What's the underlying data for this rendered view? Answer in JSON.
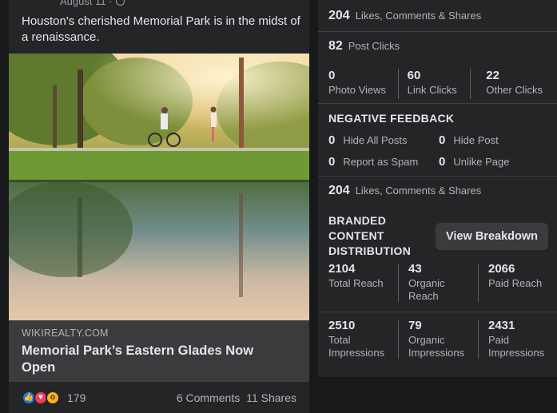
{
  "post": {
    "date": "August 11 ·",
    "text": "Houston's cherished Memorial Park is in the midst of a renaissance.",
    "link_domain": "WIKIREALTY.COM",
    "link_title": "Memorial Park’s Eastern Glades Now Open",
    "reaction_count": "179",
    "comments": "6 Comments",
    "shares": "11 Shares",
    "reaction_icons": [
      "like-icon",
      "love-icon",
      "wow-icon"
    ]
  },
  "insights": {
    "engagement_top": {
      "value": "204",
      "label": "Likes, Comments & Shares"
    },
    "post_clicks": {
      "value": "82",
      "label": "Post Clicks"
    },
    "clicks": [
      {
        "value": "0",
        "label": "Photo Views"
      },
      {
        "value": "60",
        "label": "Link Clicks"
      },
      {
        "value": "22",
        "label": "Other Clicks"
      }
    ],
    "negative_feedback": {
      "heading": "NEGATIVE FEEDBACK",
      "items": [
        {
          "value": "0",
          "label": "Hide All Posts"
        },
        {
          "value": "0",
          "label": "Hide Post"
        },
        {
          "value": "0",
          "label": "Report as Spam"
        },
        {
          "value": "0",
          "label": "Unlike Page"
        }
      ]
    },
    "engagement_bottom": {
      "value": "204",
      "label": "Likes, Comments & Shares"
    },
    "branded": {
      "heading": "BRANDED CONTENT DISTRIBUTION",
      "button": "View Breakdown",
      "reach": [
        {
          "value": "2104",
          "label": "Total Reach"
        },
        {
          "value": "43",
          "label": "Organic Reach"
        },
        {
          "value": "2066",
          "label": "Paid Reach"
        }
      ],
      "impressions": [
        {
          "value": "2510",
          "label": "Total Impressions"
        },
        {
          "value": "79",
          "label": "Organic Impressions"
        },
        {
          "value": "2431",
          "label": "Paid Impressions"
        }
      ]
    }
  },
  "colors": {
    "background": "#18191a",
    "card": "#242526",
    "button": "#3a3b3c",
    "like": "#2078f4",
    "love": "#f33e58",
    "wow": "#f7b125"
  }
}
